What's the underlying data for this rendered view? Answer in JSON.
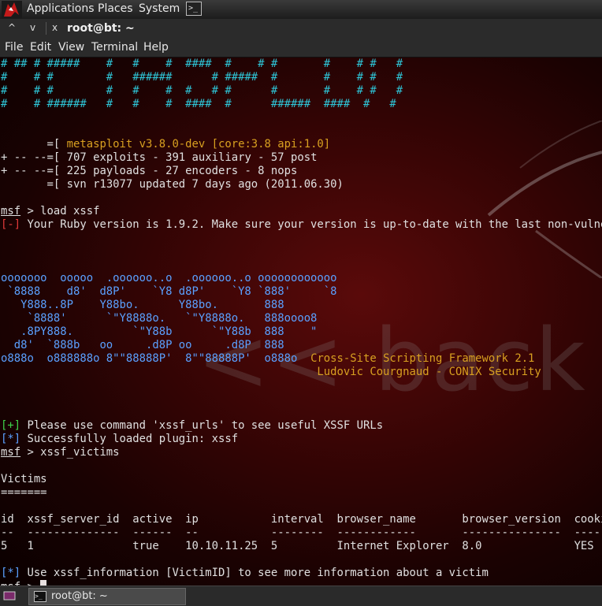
{
  "top_panel": {
    "menus": [
      "Applications",
      "Places",
      "System"
    ],
    "terminal_launcher_glyph": ">_"
  },
  "window": {
    "title": "root@bt: ~",
    "controls": [
      "^",
      "v",
      "x"
    ]
  },
  "menubar": [
    "File",
    "Edit",
    "View",
    "Terminal",
    "Help"
  ],
  "terminal": {
    "background_word": "<< back | track",
    "banner": [
      "# ## # #####    #   #    #  ####  #    # #       #    # #   #",
      "#    # #        #   ######      # #####  #       #    # #   #",
      "#    # #        #   #    #  #   # #      #       #    # #   #",
      "#    # ######   #   #    #  ####  #      ######  ####  #   #"
    ],
    "stats": [
      {
        "prefix": "       =[ ",
        "text": "metasploit v3.8.0-dev [core:3.8 api:1.0]",
        "color": "yellow"
      },
      {
        "prefix": "+ -- --=[ ",
        "text": "707 exploits - 391 auxiliary - 57 post",
        "color": "white"
      },
      {
        "prefix": "+ -- --=[ ",
        "text": "225 payloads - 27 encoders - 8 nops",
        "color": "white"
      },
      {
        "prefix": "       =[ ",
        "text": "svn r13077 updated 7 days ago (2011.06.30)",
        "color": "white"
      }
    ],
    "cmd1": {
      "prompt": "msf",
      "cmd": " > load xssf"
    },
    "ruby_warning": {
      "tag": "[-]",
      "text": " Your Ruby version is 1.9.2. Make sure your version is up-to-date with the last non-vulnerabl"
    },
    "xssf_art": [
      "ooooooo  ooooo  .oooooo..o  .oooooo..o oooooooooooo",
      " `8888    d8'  d8P'    `Y8 d8P'    `Y8 `888'     `8",
      "   Y888..8P    Y88bo.      Y88bo.       888",
      "    `8888'      `\"Y8888o.   `\"Y8888o.   888oooo8",
      "   .8PY888.         `\"Y88b      `\"Y88b  888    \"",
      "  d8'  `888b   oo     .d8P oo     .d8P  888",
      "o888o  o888888o 8\"\"88888P'  8\"\"88888P'  o888o"
    ],
    "xssf_title": "Cross-Site Scripting Framework 2.1",
    "xssf_author": "Ludovic Courgnaud - CONIX Security",
    "info1": {
      "tag": "[+]",
      "text": " Please use command 'xssf_urls' to see useful XSSF URLs"
    },
    "info2": {
      "tag": "[*]",
      "text": " Successfully loaded plugin: xssf"
    },
    "cmd2": {
      "prompt": "msf",
      "cmd": " > xssf_victims"
    },
    "victims_heading": "Victims",
    "victims_underline": "=======",
    "table": {
      "header": "id  xssf_server_id  active  ip           interval  browser_name       browser_version  cookie",
      "rule": "--  --------------  ------  --           --------  ------------       ---------------  ------",
      "rows": [
        "5   1               true    10.10.11.25  5         Internet Explorer  8.0              YES"
      ]
    },
    "info3": {
      "tag": "[*]",
      "text": " Use xssf_information [VictimID] to see more information about a victim"
    },
    "cmd3": {
      "prompt": "msf",
      "cmd": " > "
    }
  },
  "taskbar": {
    "task_label": "root@bt: ~"
  },
  "colors": {
    "cyan": "#2ec4d6",
    "yellow": "#d8a020",
    "red": "#e03a3a",
    "green": "#3fd24a",
    "blue": "#5aa0ff"
  }
}
